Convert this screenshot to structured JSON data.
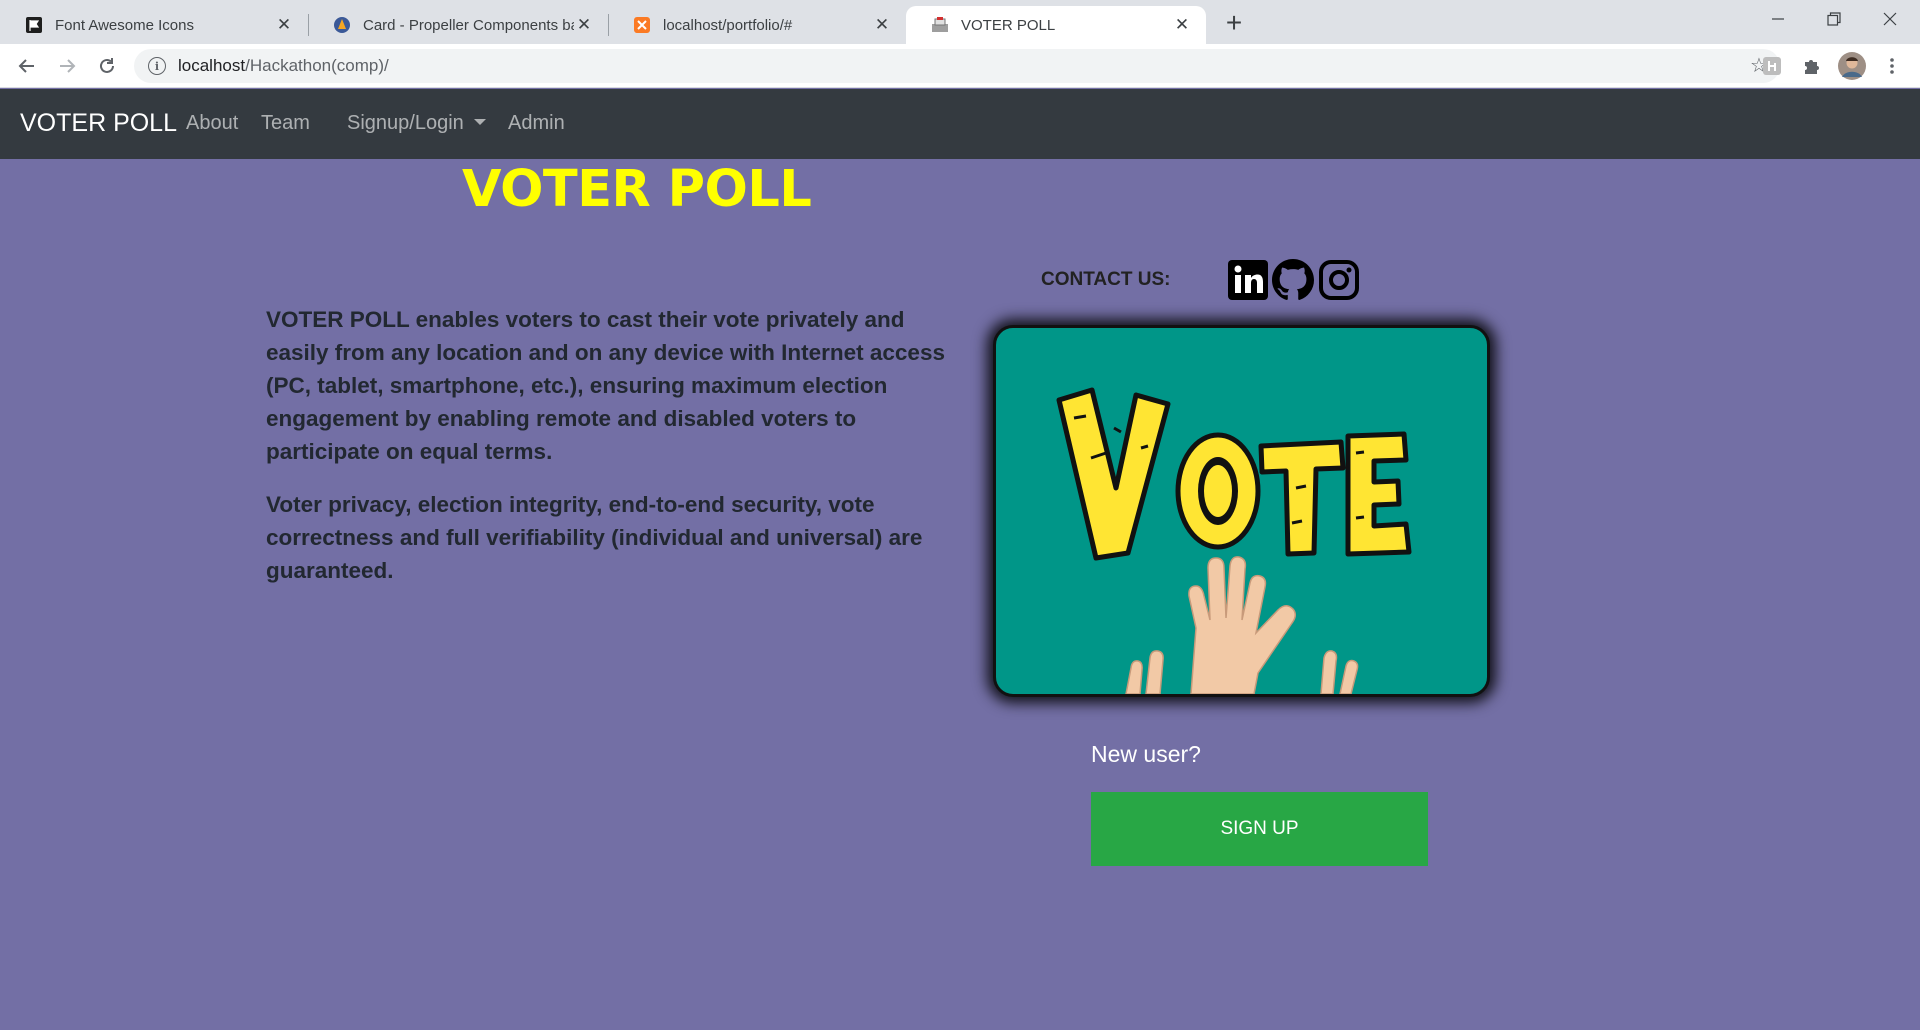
{
  "browser": {
    "tabs": [
      {
        "title": "Font Awesome Icons",
        "favicon": "flag-icon"
      },
      {
        "title": "Card - Propeller Components bas",
        "favicon": "propeller-icon"
      },
      {
        "title": "localhost/portfolio/#",
        "favicon": "xampp-icon"
      },
      {
        "title": "VOTER POLL",
        "favicon": "page-icon"
      }
    ],
    "url_host": "localhost",
    "url_path": "/Hackathon(comp)/"
  },
  "navbar": {
    "brand": "VOTER POLL",
    "links": [
      "About",
      "Team",
      "Signup/Login",
      "Admin"
    ]
  },
  "page": {
    "title": "VOTER POLL",
    "contact_label": "CONTACT US:",
    "social_icons": [
      "linkedin-icon",
      "github-icon",
      "instagram-icon"
    ],
    "paragraphs": [
      "VOTER POLL enables voters to cast their vote privately and easily from any location and on any device with Internet access (PC, tablet, smartphone, etc.), ensuring maximum election engagement by enabling remote and disabled voters to participate on equal terms.",
      "Voter privacy, election integrity, end-to-end security, vote correctness and full verifiability (individual and universal) are guaranteed."
    ],
    "image_text": "VOTE",
    "new_user_label": "New user?",
    "signup_button": "SIGN UP"
  },
  "colors": {
    "page_bg": "#736fa5",
    "navbar_bg": "#343a40",
    "title": "#ffff00",
    "card_bg": "#009688",
    "signup_bg": "#28a745"
  }
}
